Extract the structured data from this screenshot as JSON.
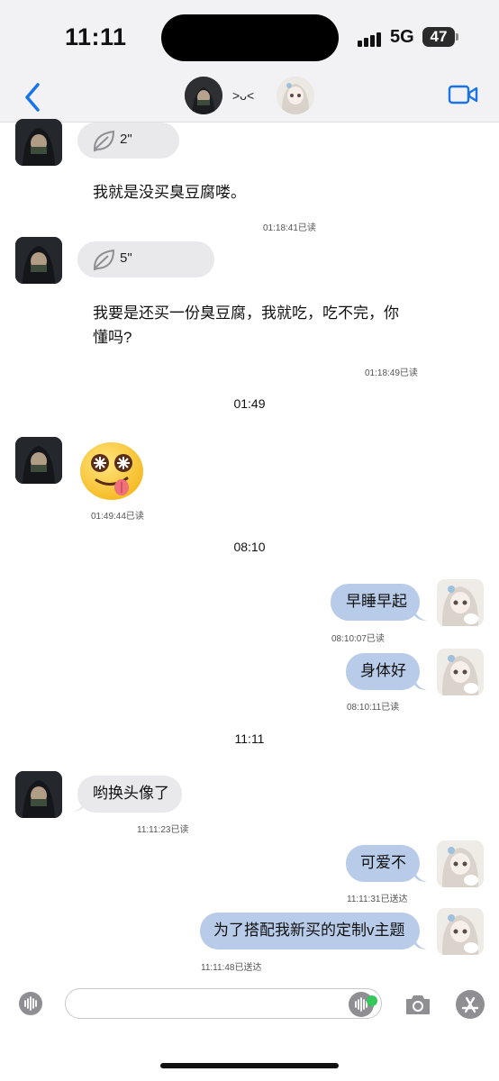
{
  "status": {
    "time": "11:11",
    "network": "5G",
    "battery": "47"
  },
  "nav": {
    "title": ">ᴗ<",
    "back_icon": "chevron-left-icon",
    "video_icon": "video-camera-icon",
    "accent": "#1a73e8"
  },
  "messages": {
    "voice1": {
      "duration": "2\""
    },
    "text1": {
      "text": "我就是没买臭豆腐喽。",
      "time": "01:18:41已读"
    },
    "voice2": {
      "duration": "5\""
    },
    "text2": {
      "line1": "我要是还买一份臭豆腐，我就吃，吃不完，你",
      "line2": "懂吗?",
      "time": "01:18:49已读"
    },
    "divider1": "01:49",
    "emoji": {
      "icon": "tongue-out-face-icon",
      "time": "01:49:44已读"
    },
    "divider2": "08:10",
    "me1": {
      "text": "早睡早起",
      "time": "08:10:07已读"
    },
    "me2": {
      "text": "身体好",
      "time": "08:10:11已读"
    },
    "divider3": "11:11",
    "them3": {
      "text": "哟换头像了",
      "time": "11:11:23已读"
    },
    "me3": {
      "text": "可爱不",
      "time": "11:11:31已送达"
    },
    "me4": {
      "text": "为了搭配我新买的定制v主题",
      "time": "11:11:48已送达"
    }
  },
  "colors": {
    "my_bubble": "#b8cce9",
    "their_bubble": "#e9e9eb"
  },
  "input": {
    "placeholder": ""
  }
}
